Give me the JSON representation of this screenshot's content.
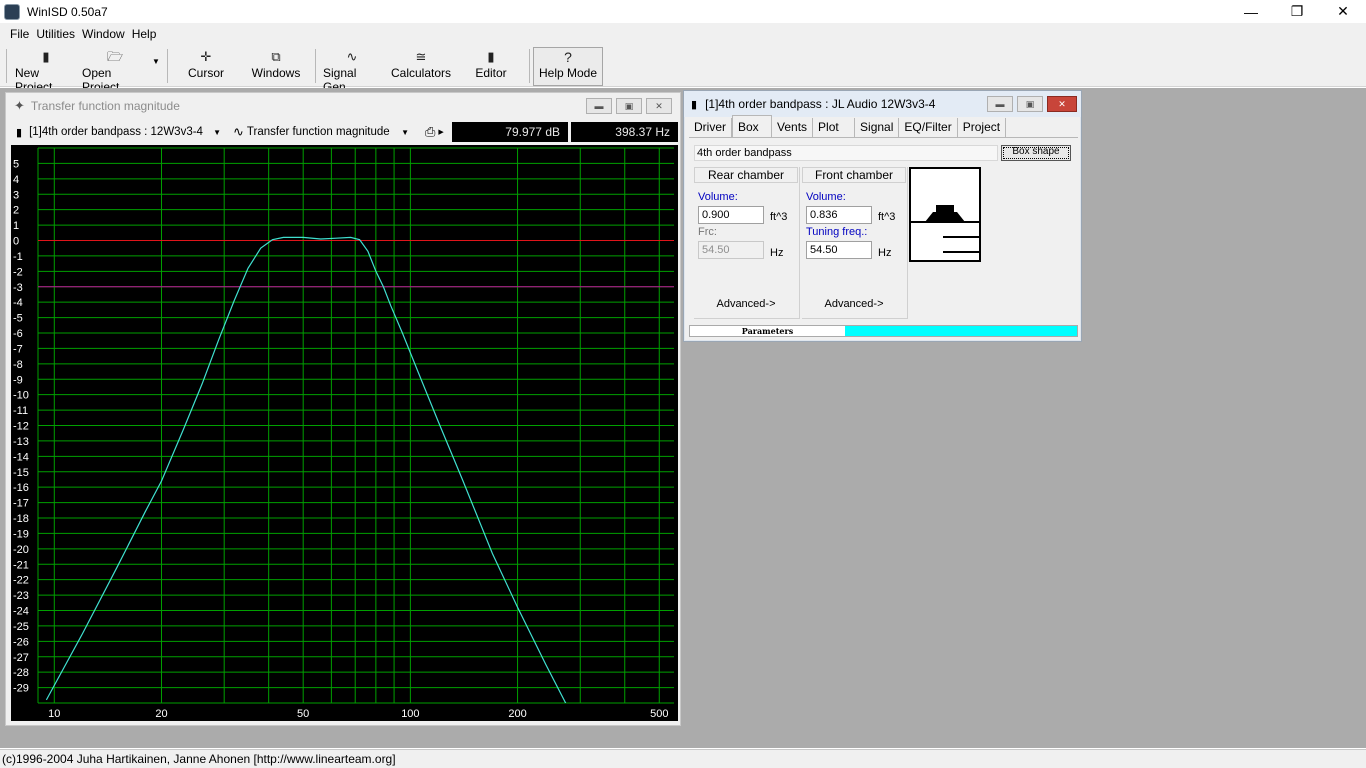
{
  "app": {
    "title": "WinISD 0.50a7",
    "status": "(c)1996-2004 Juha Hartikainen, Janne Ahonen [http://www.linearteam.org]"
  },
  "window_controls": {
    "minimize": "—",
    "restore": "❐",
    "close": "✕"
  },
  "menu": [
    {
      "label": "File"
    },
    {
      "label": "Utilities"
    },
    {
      "label": "Window"
    },
    {
      "label": "Help"
    }
  ],
  "toolbar": {
    "new_project": "New Project",
    "open_project": "Open Project",
    "cursor": "Cursor",
    "windows": "Windows",
    "signal_gen": "Signal Gen.",
    "calculators": "Calculators",
    "editor": "Editor",
    "help_mode": "Help Mode",
    "help_icon": "?"
  },
  "graph_window": {
    "title": "Transfer function magnitude",
    "project_select": "[1]4th order bandpass : 12W3v3-4",
    "graph_select": "Transfer function magnitude",
    "readout_db": "79.977 dB",
    "readout_hz": "398.37 Hz"
  },
  "chart_data": {
    "type": "line",
    "xscale": "log",
    "xlim": [
      9,
      550
    ],
    "ylim": [
      -30,
      6
    ],
    "x_tick_labels": [
      10,
      20,
      50,
      100,
      200,
      500
    ],
    "y_tick_labels": [
      5,
      4,
      3,
      2,
      1,
      0,
      -1,
      -2,
      -3,
      -4,
      -5,
      -6,
      -7,
      -8,
      -9,
      -10,
      -11,
      -12,
      -13,
      -14,
      -15,
      -16,
      -17,
      -18,
      -19,
      -20,
      -21,
      -22,
      -23,
      -24,
      -25,
      -26,
      -27,
      -28,
      -29
    ],
    "reference_lines": [
      {
        "y": 0,
        "color": "#e0141a"
      },
      {
        "y": -3,
        "color": "#c0109a"
      }
    ],
    "grid": true,
    "grid_color": "#00a000",
    "series": [
      {
        "color": "#40e0d0",
        "x": [
          9.5,
          12,
          15,
          18,
          20,
          23,
          26,
          29,
          32,
          35,
          38,
          41,
          44,
          50,
          56,
          62,
          68,
          72,
          76,
          80,
          84,
          88,
          95,
          105,
          120,
          140,
          170,
          200,
          240,
          280,
          310
        ],
        "y": [
          -29.8,
          -25.5,
          -21.2,
          -17.6,
          -15.6,
          -12.3,
          -9.3,
          -6.4,
          -3.9,
          -1.8,
          -0.5,
          0.05,
          0.2,
          0.2,
          0.1,
          0.15,
          0.2,
          0.05,
          -0.7,
          -2.0,
          -3.0,
          -4.2,
          -6.0,
          -8.5,
          -11.8,
          -15.5,
          -20.3,
          -23.8,
          -27.5,
          -30.5,
          -32.5
        ]
      }
    ]
  },
  "box_window": {
    "title": "[1]4th order bandpass : JL Audio 12W3v3-4",
    "tabs": [
      "Driver",
      "Box",
      "Vents",
      "Plot",
      "Signal",
      "EQ/Filter",
      "Project"
    ],
    "active_tab": "Box",
    "box_type": "4th order bandpass",
    "box_shape_button": "Box shape",
    "rear": {
      "header": "Rear chamber",
      "volume_label": "Volume:",
      "volume_value": "0.900",
      "volume_unit": "ft^3",
      "freq_label": "Frc:",
      "freq_value": "54.50",
      "freq_unit": "Hz",
      "advanced": "Advanced->"
    },
    "front": {
      "header": "Front chamber",
      "volume_label": "Volume:",
      "volume_value": "0.836",
      "volume_unit": "ft^3",
      "freq_label": "Tuning freq.:",
      "freq_value": "54.50",
      "freq_unit": "Hz",
      "advanced": "Advanced->"
    },
    "status_label": "Parameters"
  }
}
